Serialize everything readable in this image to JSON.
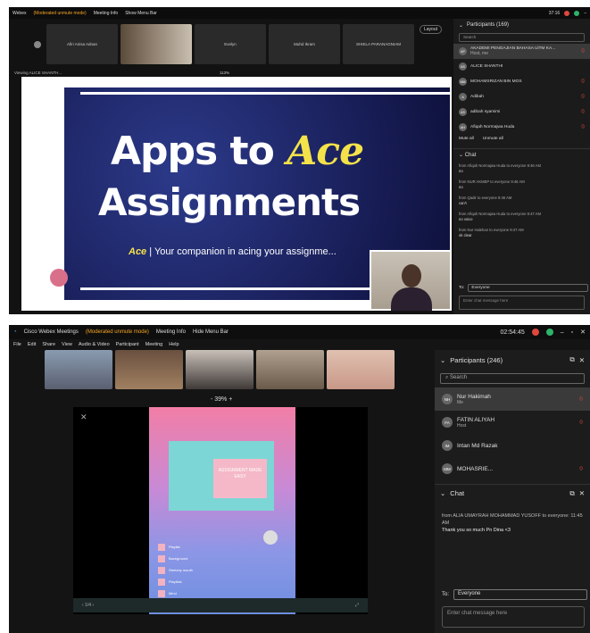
{
  "top": {
    "title": "Webex",
    "mode": "(Moderated unmute mode)",
    "meeting_info": "Meeting Info",
    "show_menu": "Show Menu Bar",
    "time": "37:16",
    "thumbs": [
      "Afiri Anisa Adnan",
      "",
      "Evelyn",
      "Muhd Ikram",
      "SHIELA PARANAGNIAM"
    ],
    "layout_label": "Layout",
    "viewing": "Viewing ALICE SHANTH...",
    "zoom": "113%",
    "slide": {
      "title_prefix": "Apps to",
      "title_accent": "Ace",
      "title_line2": "Assignments",
      "tag_accent": "Ace",
      "tagline": "| Your companion in acing your assignme..."
    },
    "participants_title": "Participants (169)",
    "search_placeholder": "Search",
    "participants": [
      {
        "name": "AKADEMI PENGAJIAN BAHASA UiTM KA...",
        "sub": "Host, me",
        "initials": "AP",
        "selected": true
      },
      {
        "name": "ALICE SHANTHI",
        "initials": "AS"
      },
      {
        "name": "MOHAMSRIZAN BIN MOS",
        "initials": "MM"
      },
      {
        "name": "Adibah",
        "initials": "A"
      },
      {
        "name": "adibah syamimi",
        "initials": "AS"
      },
      {
        "name": "Afiqah Normajwa Huda",
        "initials": "AH"
      }
    ],
    "mute_all": "Mute all",
    "unmute_all": "Unmute all",
    "chat_title": "Chat",
    "messages": [
      {
        "from": "from Afiqah Normajwa Huda to everyone  9:46 AM",
        "text": "no"
      },
      {
        "from": "from NUR AKMEP to everyone  9:46 AM",
        "text": "no"
      },
      {
        "from": "from Qadir to everyone  9:46 AM",
        "text": "can't"
      },
      {
        "from": "from Afiqah Normajwa Huda to everyone  9:47 AM",
        "text": "no voice"
      },
      {
        "from": "from Nur Halehan to everyone  9:47 AM",
        "text": "ok clear"
      }
    ],
    "to_label": "To:",
    "to_value": "Everyone",
    "input_placeholder": "Enter chat message here"
  },
  "bottom": {
    "title": "Cisco Webex Meetings",
    "mode": "(Moderated unmute mode)",
    "meeting_info": "Meeting Info",
    "hide_menu": "Hide Menu Bar",
    "time": "02:54:45",
    "menu": [
      "File",
      "Edit",
      "Share",
      "View",
      "Audio & Video",
      "Participant",
      "Meeting",
      "Help"
    ],
    "zoom": "- 39% +",
    "phone": {
      "card_text": "ASSIGNMENT MADE EASY",
      "items": [
        "Playlist",
        "Background",
        "Stretchy mouth",
        "Playlists",
        "Mind"
      ]
    },
    "participants_title": "Participants (246)",
    "search_placeholder": "Search",
    "participants": [
      {
        "name": "Nur Hakimah",
        "sub": "Me",
        "initials": "NH",
        "selected": true
      },
      {
        "name": "FATIN ALIYAH",
        "sub": "Host",
        "initials": "FA"
      },
      {
        "name": "Intan Md Razak",
        "initials": "IM"
      },
      {
        "name": "MOHASRIE...",
        "initials": "MM"
      }
    ],
    "chat_title": "Chat",
    "message_from": "from ALIA UMAYRAH MOHAMMAD YUSOFF to everyone:  11:45 AM",
    "message_text": "Thank you so much Pn Dina <3",
    "to_label": "To:",
    "to_value": "Everyone",
    "input_placeholder": "Enter chat message here"
  }
}
